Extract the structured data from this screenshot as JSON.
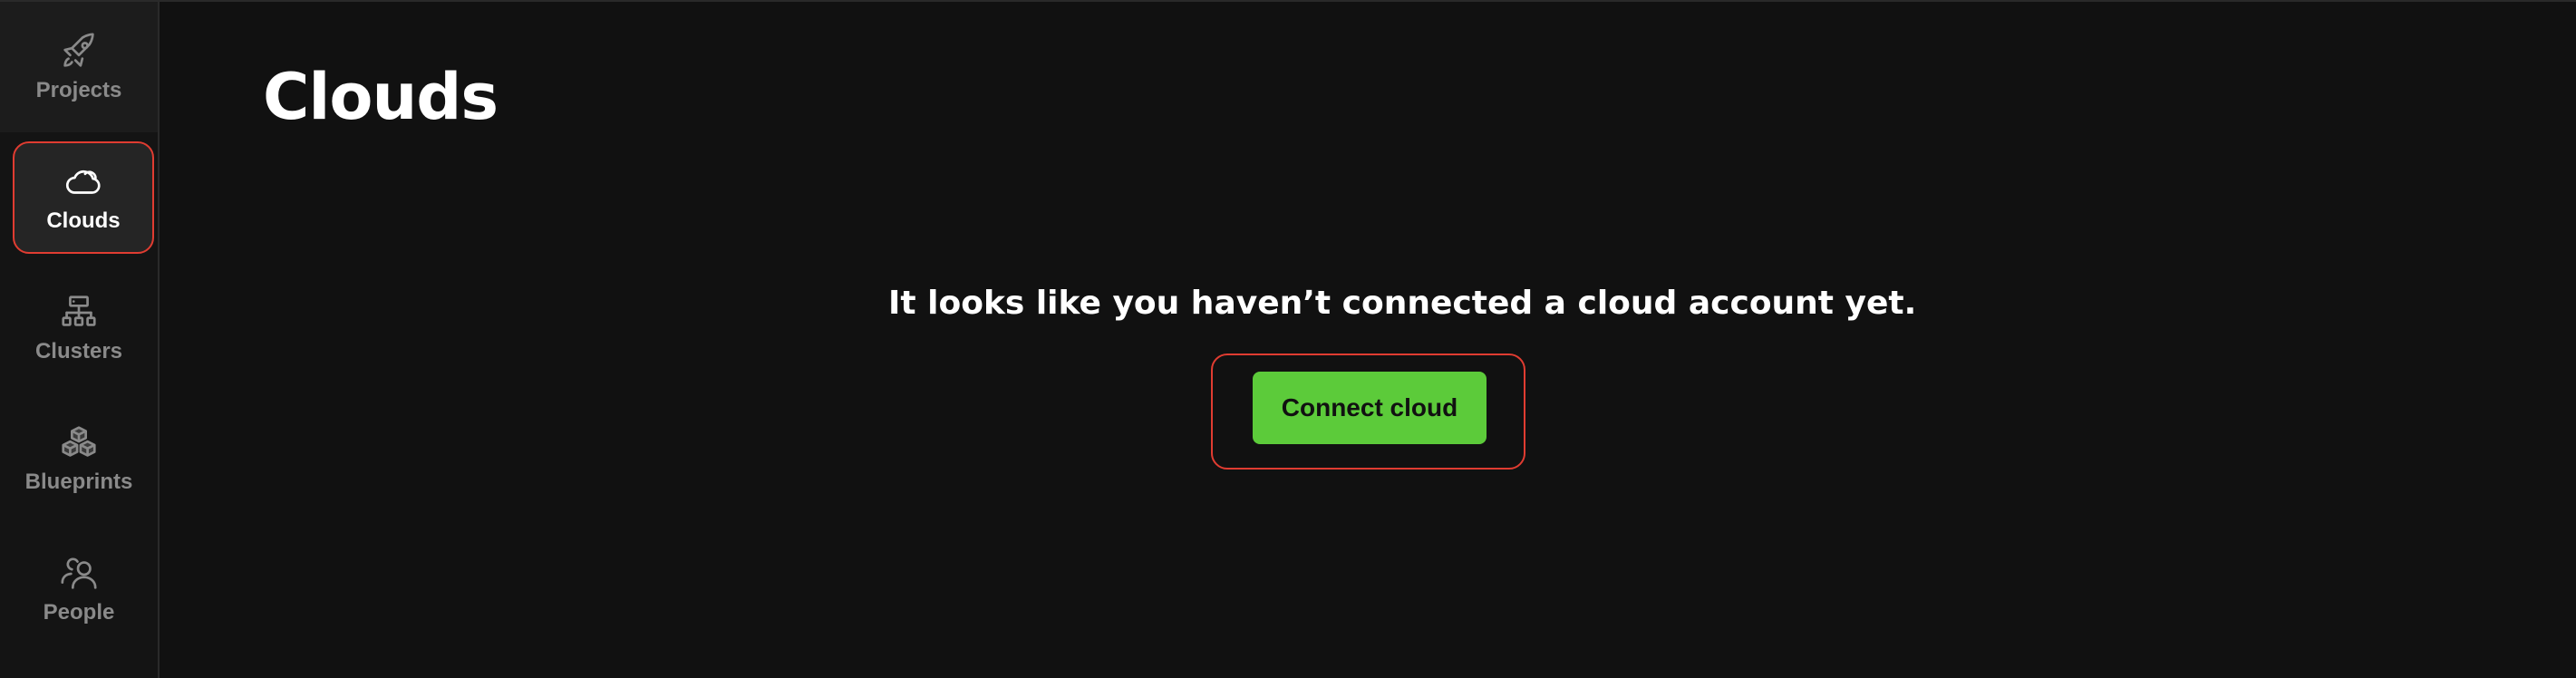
{
  "sidebar": {
    "items": [
      {
        "label": "Projects",
        "icon": "rocket-icon",
        "active": false
      },
      {
        "label": "Clouds",
        "icon": "cloud-icon",
        "active": true
      },
      {
        "label": "Clusters",
        "icon": "cluster-icon",
        "active": false
      },
      {
        "label": "Blueprints",
        "icon": "cubes-icon",
        "active": false
      },
      {
        "label": "People",
        "icon": "people-icon",
        "active": false
      }
    ]
  },
  "page": {
    "title": "Clouds"
  },
  "empty_state": {
    "message": "It looks like you haven’t connected a cloud account yet.",
    "button_label": "Connect cloud"
  },
  "colors": {
    "background": "#111111",
    "sidebar": "#141414",
    "accent_green": "#5ccb3a",
    "highlight_red": "#e03c31",
    "muted_text": "#8a8a8a"
  }
}
